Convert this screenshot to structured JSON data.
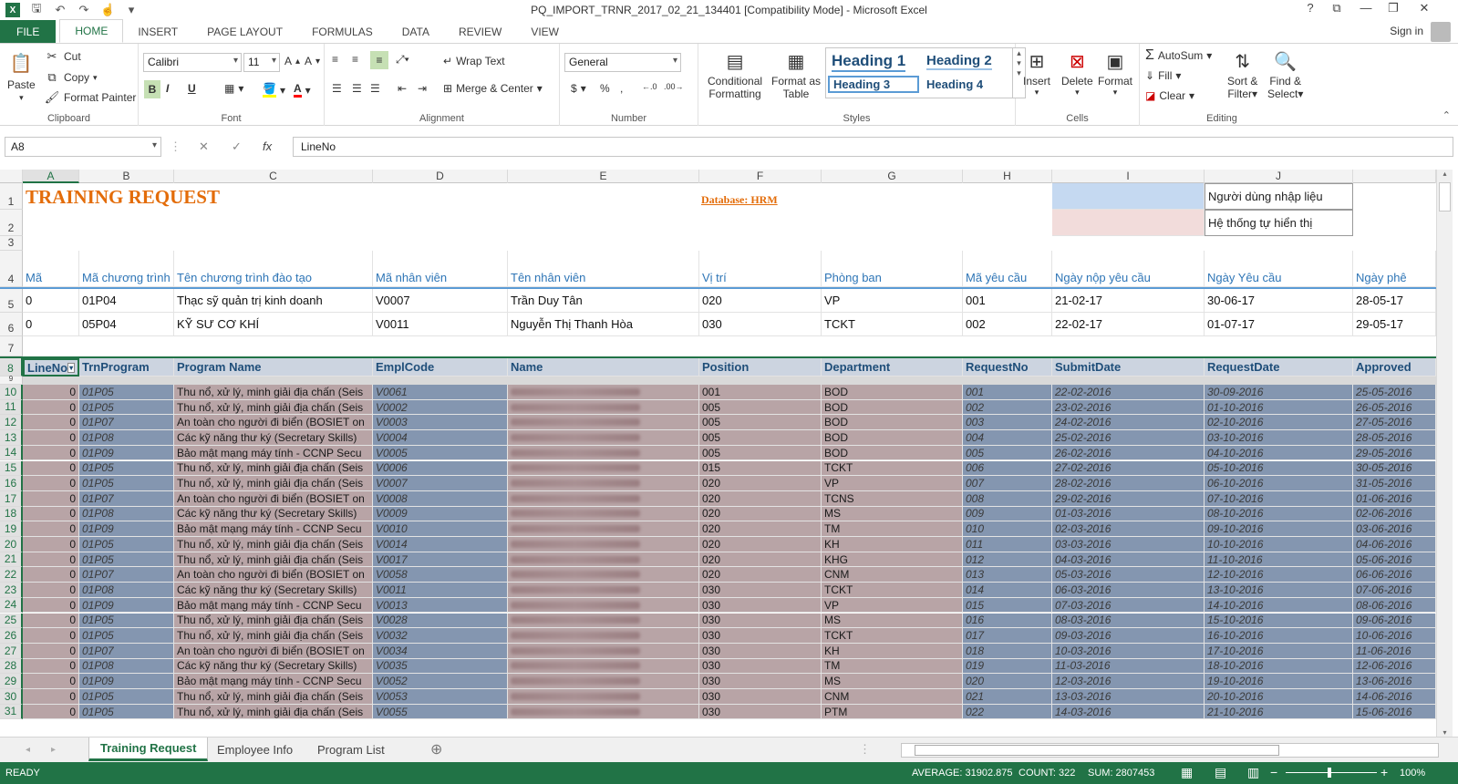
{
  "titlebar": {
    "title": "PQ_IMPORT_TRNR_2017_02_21_134401  [Compatibility Mode] - Microsoft Excel",
    "help": "?",
    "restore": "⧉",
    "minimize": "—",
    "maximize": "❐",
    "close": "✕"
  },
  "tabs": [
    "FILE",
    "HOME",
    "INSERT",
    "PAGE LAYOUT",
    "FORMULAS",
    "DATA",
    "REVIEW",
    "VIEW"
  ],
  "signin": "Sign in",
  "ribbon": {
    "clipboard": {
      "paste": "Paste",
      "cut": "Cut",
      "copy": "Copy",
      "format_painter": "Format Painter",
      "label": "Clipboard"
    },
    "font": {
      "name": "Calibri",
      "size": "11",
      "bold": "B",
      "italic": "I",
      "underline": "U",
      "label": "Font"
    },
    "alignment": {
      "wrap": "Wrap Text",
      "merge": "Merge & Center",
      "label": "Alignment"
    },
    "number": {
      "format": "General",
      "currency": "$",
      "percent": "%",
      "comma": ",",
      "label": "Number"
    },
    "styles": {
      "conditional": "Conditional",
      "conditional2": "Formatting",
      "format_as": "Format as",
      "format_as2": "Table",
      "h1": "Heading 1",
      "h2": "Heading 2",
      "h3": "Heading 3",
      "h4": "Heading 4",
      "label": "Styles"
    },
    "cells": {
      "insert": "Insert",
      "delete": "Delete",
      "format": "Format",
      "label": "Cells"
    },
    "editing": {
      "autosum": "AutoSum",
      "fill": "Fill",
      "clear": "Clear",
      "sort": "Sort &",
      "sort2": "Filter",
      "find": "Find &",
      "find2": "Select",
      "label": "Editing"
    }
  },
  "formula_bar": {
    "name_box": "A8",
    "cancel": "✕",
    "enter": "✓",
    "fx": "fx",
    "formula": "LineNo"
  },
  "columns": [
    "A",
    "B",
    "C",
    "D",
    "E",
    "F",
    "G",
    "H",
    "I",
    "J"
  ],
  "sheet": {
    "title": "TRAINING REQUEST",
    "database": "Database: HRM",
    "legend_user": "Người dùng nhập liệu",
    "legend_system": "Hệ thống tự hiển thị",
    "headers_vi": [
      "Mã",
      "Mã chương trình",
      "Tên chương trình đào tạo",
      "Mã nhân viên",
      "Tên nhân viên",
      "Vị trí",
      "Phòng ban",
      "Mã yêu cầu",
      "Ngày nộp yêu cầu",
      "Ngày Yêu cầu",
      "Ngày phê"
    ],
    "sample_rows": [
      [
        "0",
        "01P04",
        "Thạc sỹ quản trị kinh doanh",
        "V0007",
        "Trần Duy  Tân",
        "020",
        "VP",
        "001",
        "21-02-17",
        "30-06-17",
        "28-05-17"
      ],
      [
        "0",
        "05P04",
        "KỸ SƯ CƠ KHÍ",
        "V0011",
        "Nguyễn Thị Thanh  Hòa",
        "030",
        "TCKT",
        "002",
        "22-02-17",
        "01-07-17",
        "29-05-17"
      ]
    ],
    "headers_en": [
      "LineNo",
      "TrnProgram",
      "Program Name",
      "EmplCode",
      "Name",
      "Position",
      "Department",
      "RequestNo",
      "SubmitDate",
      "RequestDate",
      "Approved"
    ],
    "data_rows": [
      {
        "r": "10",
        "line": "0",
        "prog": "01P05",
        "pname": "Thu nổ, xử lý, minh giải địa chấn (Seis",
        "emp": "V0061",
        "pos": "001",
        "dept": "BOD",
        "req": "001",
        "sub": "22-02-2016",
        "rdate": "30-09-2016",
        "appr": "25-05-2016"
      },
      {
        "r": "11",
        "line": "0",
        "prog": "01P05",
        "pname": "Thu nổ, xử lý, minh giải địa chấn (Seis",
        "emp": "V0002",
        "pos": "005",
        "dept": "BOD",
        "req": "002",
        "sub": "23-02-2016",
        "rdate": "01-10-2016",
        "appr": "26-05-2016"
      },
      {
        "r": "12",
        "line": "0",
        "prog": "01P07",
        "pname": "An toàn cho người đi biển (BOSIET on",
        "emp": "V0003",
        "pos": "005",
        "dept": "BOD",
        "req": "003",
        "sub": "24-02-2016",
        "rdate": "02-10-2016",
        "appr": "27-05-2016"
      },
      {
        "r": "13",
        "line": "0",
        "prog": "01P08",
        "pname": "Các kỹ năng thư ký (Secretary Skills)",
        "emp": "V0004",
        "pos": "005",
        "dept": "BOD",
        "req": "004",
        "sub": "25-02-2016",
        "rdate": "03-10-2016",
        "appr": "28-05-2016"
      },
      {
        "r": "14",
        "line": "0",
        "prog": "01P09",
        "pname": "Bảo mật mạng máy tính - CCNP Secu",
        "emp": "V0005",
        "pos": "005",
        "dept": "BOD",
        "req": "005",
        "sub": "26-02-2016",
        "rdate": "04-10-2016",
        "appr": "29-05-2016"
      },
      {
        "r": "15",
        "line": "0",
        "prog": "01P05",
        "pname": "Thu nổ, xử lý, minh giải địa chấn (Seis",
        "emp": "V0006",
        "pos": "015",
        "dept": "TCKT",
        "req": "006",
        "sub": "27-02-2016",
        "rdate": "05-10-2016",
        "appr": "30-05-2016"
      },
      {
        "r": "16",
        "line": "0",
        "prog": "01P05",
        "pname": "Thu nổ, xử lý, minh giải địa chấn (Seis",
        "emp": "V0007",
        "pos": "020",
        "dept": "VP",
        "req": "007",
        "sub": "28-02-2016",
        "rdate": "06-10-2016",
        "appr": "31-05-2016"
      },
      {
        "r": "17",
        "line": "0",
        "prog": "01P07",
        "pname": "An toàn cho người đi biển (BOSIET on",
        "emp": "V0008",
        "pos": "020",
        "dept": "TCNS",
        "req": "008",
        "sub": "29-02-2016",
        "rdate": "07-10-2016",
        "appr": "01-06-2016"
      },
      {
        "r": "18",
        "line": "0",
        "prog": "01P08",
        "pname": "Các kỹ năng thư ký (Secretary Skills)",
        "emp": "V0009",
        "pos": "020",
        "dept": "MS",
        "req": "009",
        "sub": "01-03-2016",
        "rdate": "08-10-2016",
        "appr": "02-06-2016"
      },
      {
        "r": "19",
        "line": "0",
        "prog": "01P09",
        "pname": "Bảo mật mạng máy tính - CCNP Secu",
        "emp": "V0010",
        "pos": "020",
        "dept": "TM",
        "req": "010",
        "sub": "02-03-2016",
        "rdate": "09-10-2016",
        "appr": "03-06-2016"
      },
      {
        "r": "20",
        "line": "0",
        "prog": "01P05",
        "pname": "Thu nổ, xử lý, minh giải địa chấn (Seis",
        "emp": "V0014",
        "pos": "020",
        "dept": "KH",
        "req": "011",
        "sub": "03-03-2016",
        "rdate": "10-10-2016",
        "appr": "04-06-2016"
      },
      {
        "r": "21",
        "line": "0",
        "prog": "01P05",
        "pname": "Thu nổ, xử lý, minh giải địa chấn (Seis",
        "emp": "V0017",
        "pos": "020",
        "dept": "KHG",
        "req": "012",
        "sub": "04-03-2016",
        "rdate": "11-10-2016",
        "appr": "05-06-2016"
      },
      {
        "r": "22",
        "line": "0",
        "prog": "01P07",
        "pname": "An toàn cho người đi biển (BOSIET on",
        "emp": "V0058",
        "pos": "020",
        "dept": "CNM",
        "req": "013",
        "sub": "05-03-2016",
        "rdate": "12-10-2016",
        "appr": "06-06-2016"
      },
      {
        "r": "23",
        "line": "0",
        "prog": "01P08",
        "pname": "Các kỹ năng thư ký (Secretary Skills)",
        "emp": "V0011",
        "pos": "030",
        "dept": "TCKT",
        "req": "014",
        "sub": "06-03-2016",
        "rdate": "13-10-2016",
        "appr": "07-06-2016"
      },
      {
        "r": "24",
        "line": "0",
        "prog": "01P09",
        "pname": "Bảo mật mạng máy tính - CCNP Secu",
        "emp": "V0013",
        "pos": "030",
        "dept": "VP",
        "req": "015",
        "sub": "07-03-2016",
        "rdate": "14-10-2016",
        "appr": "08-06-2016"
      },
      {
        "r": "25",
        "line": "0",
        "prog": "01P05",
        "pname": "Thu nổ, xử lý, minh giải địa chấn (Seis",
        "emp": "V0028",
        "pos": "030",
        "dept": "MS",
        "req": "016",
        "sub": "08-03-2016",
        "rdate": "15-10-2016",
        "appr": "09-06-2016"
      },
      {
        "r": "26",
        "line": "0",
        "prog": "01P05",
        "pname": "Thu nổ, xử lý, minh giải địa chấn (Seis",
        "emp": "V0032",
        "pos": "030",
        "dept": "TCKT",
        "req": "017",
        "sub": "09-03-2016",
        "rdate": "16-10-2016",
        "appr": "10-06-2016"
      },
      {
        "r": "27",
        "line": "0",
        "prog": "01P07",
        "pname": "An toàn cho người đi biển (BOSIET on",
        "emp": "V0034",
        "pos": "030",
        "dept": "KH",
        "req": "018",
        "sub": "10-03-2016",
        "rdate": "17-10-2016",
        "appr": "11-06-2016"
      },
      {
        "r": "28",
        "line": "0",
        "prog": "01P08",
        "pname": "Các kỹ năng thư ký (Secretary Skills)",
        "emp": "V0035",
        "pos": "030",
        "dept": "TM",
        "req": "019",
        "sub": "11-03-2016",
        "rdate": "18-10-2016",
        "appr": "12-06-2016"
      },
      {
        "r": "29",
        "line": "0",
        "prog": "01P09",
        "pname": "Bảo mật mạng máy tính - CCNP Secu",
        "emp": "V0052",
        "pos": "030",
        "dept": "MS",
        "req": "020",
        "sub": "12-03-2016",
        "rdate": "19-10-2016",
        "appr": "13-06-2016"
      },
      {
        "r": "30",
        "line": "0",
        "prog": "01P05",
        "pname": "Thu nổ, xử lý, minh giải địa chấn (Seis",
        "emp": "V0053",
        "pos": "030",
        "dept": "CNM",
        "req": "021",
        "sub": "13-03-2016",
        "rdate": "20-10-2016",
        "appr": "14-06-2016"
      },
      {
        "r": "31",
        "line": "0",
        "prog": "01P05",
        "pname": "Thu nổ, xử lý, minh giải địa chấn (Seis",
        "emp": "V0055",
        "pos": "030",
        "dept": "PTM",
        "req": "022",
        "sub": "14-03-2016",
        "rdate": "21-10-2016",
        "appr": "15-06-2016"
      }
    ]
  },
  "sheet_tabs": [
    "Training Request",
    "Employee Info",
    "Program List"
  ],
  "status": {
    "ready": "READY",
    "average": "AVERAGE: 31902.875",
    "count": "COUNT: 322",
    "sum": "SUM: 2807453",
    "zoom": "100%"
  }
}
